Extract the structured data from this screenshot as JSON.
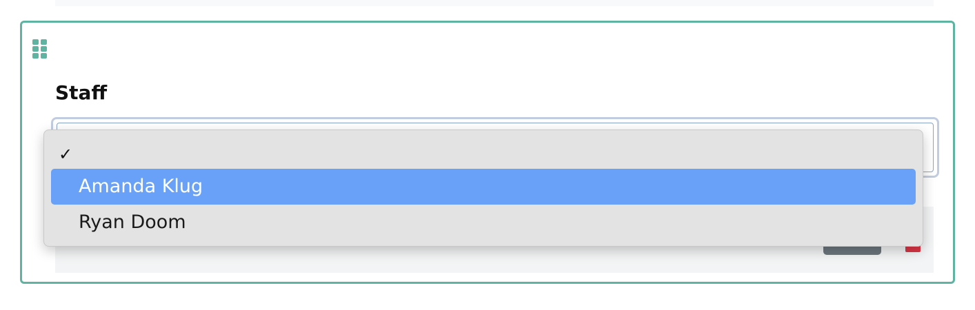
{
  "field": {
    "label": "Staff"
  },
  "dropdown": {
    "checkmark": "✓",
    "options": [
      {
        "label": "",
        "selected": true
      },
      {
        "label": "Amanda Klug",
        "highlighted": true
      },
      {
        "label": "Ryan Doom"
      }
    ]
  },
  "colors": {
    "card_border": "#5fb3a1",
    "highlight": "#68a1f7"
  }
}
